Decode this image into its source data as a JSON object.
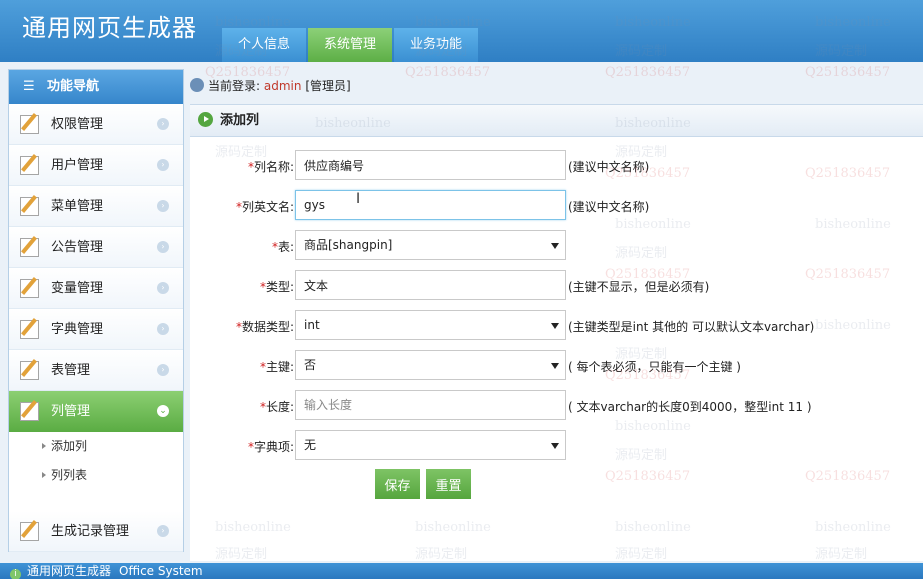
{
  "app": {
    "title": "通用网页生成器"
  },
  "top_nav": [
    {
      "label": "个人信息",
      "active": false
    },
    {
      "label": "系统管理",
      "active": true
    },
    {
      "label": "业务功能",
      "active": false
    }
  ],
  "sidebar": {
    "title": "功能导航",
    "items": [
      {
        "label": "权限管理",
        "icon": "edit-icon"
      },
      {
        "label": "用户管理",
        "icon": "edit-icon"
      },
      {
        "label": "菜单管理",
        "icon": "edit-icon"
      },
      {
        "label": "公告管理",
        "icon": "edit-icon"
      },
      {
        "label": "变量管理",
        "icon": "edit-icon"
      },
      {
        "label": "字典管理",
        "icon": "edit-icon"
      },
      {
        "label": "表管理",
        "icon": "edit-icon"
      },
      {
        "label": "列管理",
        "icon": "edit-icon",
        "active": true
      }
    ],
    "sub_items": [
      {
        "label": "添加列"
      },
      {
        "label": "列列表"
      }
    ],
    "last_item": {
      "label": "生成记录管理",
      "icon": "edit-icon"
    }
  },
  "login": {
    "prefix": "当前登录:",
    "user": "admin",
    "role": "[管理员]"
  },
  "panel": {
    "title": "添加列"
  },
  "form": {
    "name": {
      "label": "列名称:",
      "value": "供应商编号",
      "hint": "(建议中文名称)"
    },
    "en_name": {
      "label": "列英文名:",
      "value": "gys",
      "hint": "(建议中文名称)"
    },
    "table": {
      "label": "表:",
      "value": "商品[shangpin]"
    },
    "type": {
      "label": "类型:",
      "value": "文本",
      "hint": "(主键不显示，但是必须有)"
    },
    "data_type": {
      "label": "数据类型:",
      "value": "int",
      "hint": "(主键类型是int 其他的 可以默认文本varchar)"
    },
    "primary_key": {
      "label": "主键:",
      "value": "否",
      "hint": "( 每个表必须，只能有一个主键 )"
    },
    "length": {
      "label": "长度:",
      "placeholder": "输入长度",
      "hint": "( 文本varchar的长度0到4000，整型int 11 )"
    },
    "dict": {
      "label": "字典项:",
      "value": "无"
    },
    "required_mark": "*"
  },
  "buttons": {
    "save": "保存",
    "reset": "重置"
  },
  "footer": {
    "name": "通用网页生成器",
    "system": "Office System"
  },
  "watermark": {
    "text1": "bisheonline",
    "text2": "源码定制",
    "text3": "Q2518364​57"
  },
  "colors": {
    "header": "#3a8bd0",
    "accent_green": "#5daf46",
    "required": "#d02020"
  }
}
